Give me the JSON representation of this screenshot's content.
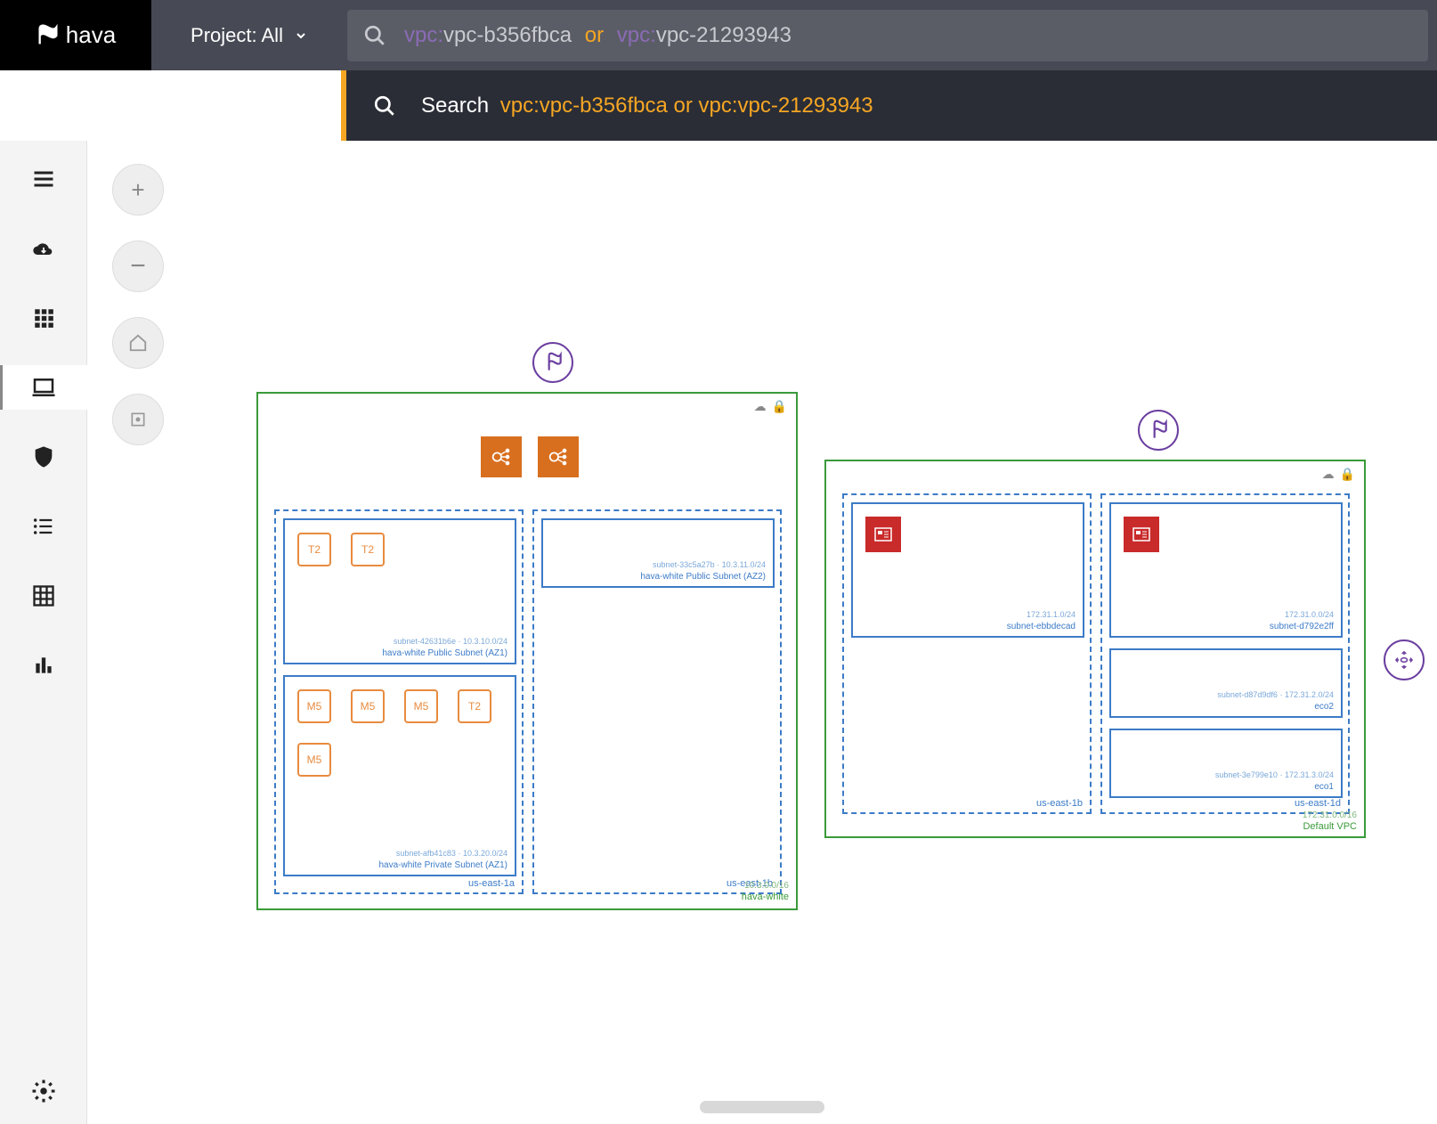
{
  "header": {
    "brand": "hava",
    "project_label": "Project: All",
    "search_prefix": "vpc:",
    "search_term1": "vpc-b356fbca",
    "search_or": "or",
    "search_term2": "vpc-21293943"
  },
  "suggestion": {
    "prefix": "Search",
    "q": "vpc:vpc-b356fbca or vpc:vpc-21293943"
  },
  "rail": {
    "items": [
      "menu",
      "cloud-download",
      "grid-apps",
      "laptop",
      "shield",
      "list",
      "table",
      "bar-chart"
    ],
    "active_index": 3
  },
  "zoom": {
    "in": "+",
    "out": "−",
    "home": "⌂",
    "record": "◉"
  },
  "diagram": {
    "vpc1": {
      "name": "hava-white",
      "cidr": "10.3.0.0/16",
      "azs": [
        {
          "name": "us-east-1a",
          "subnets": [
            {
              "id": "subnet-42631b6e",
              "cidr": "10.3.10.0/24",
              "name": "hava-white Public Subnet (AZ1)",
              "instances": [
                {
                  "t": "T2"
                },
                {
                  "t": "T2"
                }
              ]
            },
            {
              "id": "subnet-afb41c83",
              "cidr": "10.3.20.0/24",
              "name": "hava-white Private Subnet (AZ1)",
              "instances": [
                {
                  "t": "M5"
                },
                {
                  "t": "M5"
                },
                {
                  "t": "M5"
                },
                {
                  "t": "T2"
                },
                {
                  "t": "M5"
                }
              ]
            }
          ]
        },
        {
          "name": "us-east-1b",
          "subnets": [
            {
              "id": "subnet-33c5a27b",
              "cidr": "10.3.11.0/24",
              "name": "hava-white Public Subnet (AZ2)",
              "instances": []
            }
          ]
        }
      ]
    },
    "vpc2": {
      "name": "Default VPC",
      "cidr": "172.31.0.0/16",
      "azs": [
        {
          "name": "us-east-1b",
          "subnets": [
            {
              "id": "subnet-ebbdecad",
              "cidr": "172.31.1.0/24",
              "name": "",
              "redvm": true
            }
          ]
        },
        {
          "name": "us-east-1d",
          "subnets": [
            {
              "id": "subnet-d792e2ff",
              "cidr": "172.31.0.0/24",
              "name": "",
              "redvm": true
            },
            {
              "id": "subnet-d87d9df6",
              "cidr": "172.31.2.0/24",
              "name": "eco2"
            },
            {
              "id": "subnet-3e799e10",
              "cidr": "172.31.3.0/24",
              "name": "eco1"
            }
          ]
        }
      ]
    }
  }
}
